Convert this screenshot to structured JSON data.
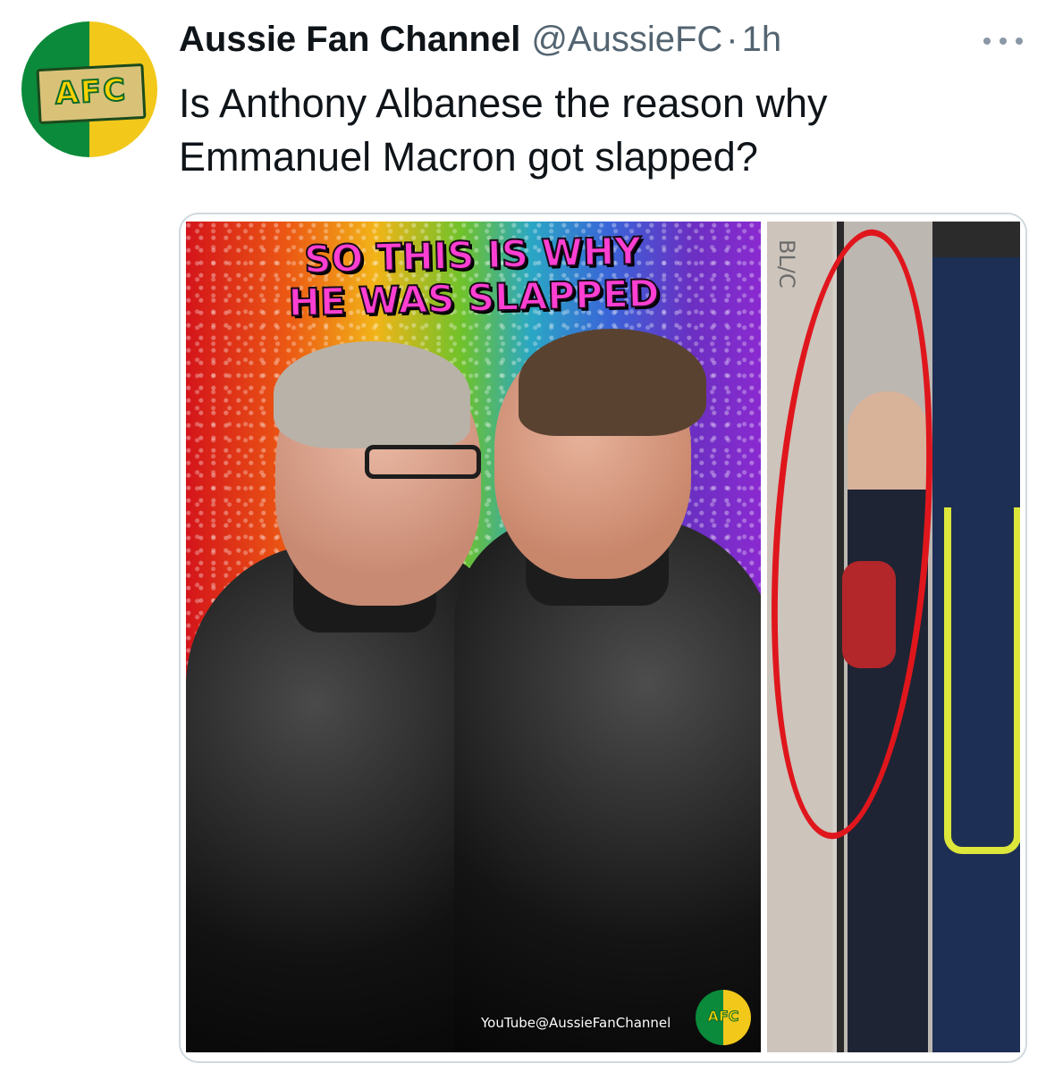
{
  "tweet": {
    "author": {
      "display_name": "Aussie Fan Channel",
      "handle": "@AussieFC",
      "separator": "·",
      "time": "1h",
      "avatar_text": "AFC"
    },
    "more_icon": "more-horizontal-icon",
    "text": "Is Anthony Albanese the reason why Emmanuel Macron got slapped?",
    "media": {
      "left_image": {
        "caption_line1": "SO THIS IS WHY",
        "caption_line2": "HE WAS SLAPPED",
        "watermark_text": "YouTube@AussieFanChannel",
        "watermark_logo_text": "AFC"
      },
      "right_image": {
        "wall_letters": "BL/C"
      }
    }
  },
  "colors": {
    "text_primary": "#0f1419",
    "text_secondary": "#536471",
    "border": "#cfd9de",
    "caption_pink": "#ff3fd2",
    "highlight_ring": "#e0161d",
    "avatar_green": "#0a8a3a",
    "avatar_yellow": "#f2c81a"
  }
}
